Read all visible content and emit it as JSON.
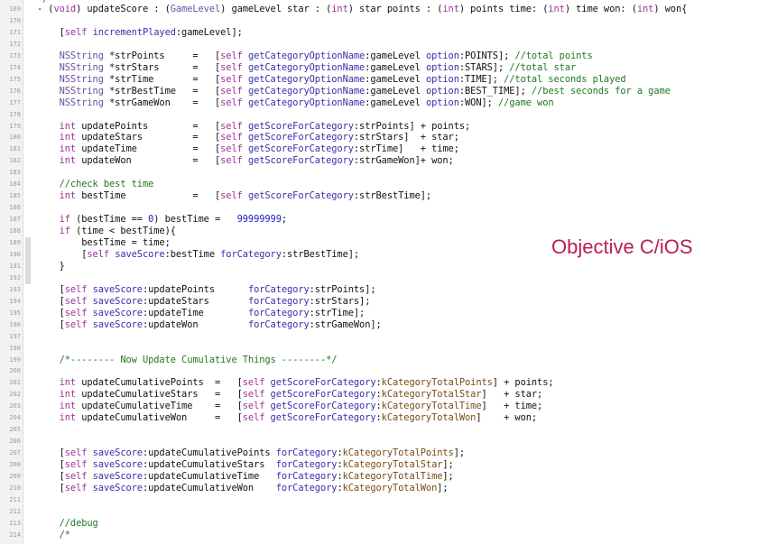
{
  "title_label": "Objective C/iOS",
  "code_lines": [
    {
      "ln": "",
      "y": -7,
      "seg": [
        [
          "cm",
          "*/"
        ]
      ]
    },
    {
      "ln": "169",
      "seg": [
        [
          "",
          "- ("
        ],
        [
          "kw",
          "void"
        ],
        [
          "",
          ") updateScore : ("
        ],
        [
          "cl",
          "GameLevel"
        ],
        [
          "",
          ") gameLevel star : ("
        ],
        [
          "kw",
          "int"
        ],
        [
          "",
          ") star points : ("
        ],
        [
          "kw",
          "int"
        ],
        [
          "",
          ") points time: ("
        ],
        [
          "kw",
          "int"
        ],
        [
          "",
          ") time won: ("
        ],
        [
          "kw",
          "int"
        ],
        [
          "",
          ") won{"
        ]
      ]
    },
    {
      "ln": "170",
      "seg": []
    },
    {
      "ln": "171",
      "seg": [
        [
          "",
          "    ["
        ],
        [
          "kw",
          "self"
        ],
        [
          "",
          " "
        ],
        [
          "fn",
          "incrementPlayed"
        ],
        [
          "",
          ":gameLevel];"
        ]
      ]
    },
    {
      "ln": "172",
      "seg": []
    },
    {
      "ln": "173",
      "seg": [
        [
          "",
          "    "
        ],
        [
          "cl",
          "NSString"
        ],
        [
          "",
          " *strPoints     =   ["
        ],
        [
          "kw",
          "self"
        ],
        [
          "",
          " "
        ],
        [
          "fn",
          "getCategoryOptionName"
        ],
        [
          "",
          ":gameLevel "
        ],
        [
          "fn",
          "option"
        ],
        [
          "",
          ":POINTS]; "
        ],
        [
          "cm",
          "//total points"
        ]
      ]
    },
    {
      "ln": "174",
      "seg": [
        [
          "",
          "    "
        ],
        [
          "cl",
          "NSString"
        ],
        [
          "",
          " *strStars      =   ["
        ],
        [
          "kw",
          "self"
        ],
        [
          "",
          " "
        ],
        [
          "fn",
          "getCategoryOptionName"
        ],
        [
          "",
          ":gameLevel "
        ],
        [
          "fn",
          "option"
        ],
        [
          "",
          ":STARS]; "
        ],
        [
          "cm",
          "//total star"
        ]
      ]
    },
    {
      "ln": "175",
      "seg": [
        [
          "",
          "    "
        ],
        [
          "cl",
          "NSString"
        ],
        [
          "",
          " *strTime       =   ["
        ],
        [
          "kw",
          "self"
        ],
        [
          "",
          " "
        ],
        [
          "fn",
          "getCategoryOptionName"
        ],
        [
          "",
          ":gameLevel "
        ],
        [
          "fn",
          "option"
        ],
        [
          "",
          ":TIME]; "
        ],
        [
          "cm",
          "//total seconds played"
        ]
      ]
    },
    {
      "ln": "176",
      "seg": [
        [
          "",
          "    "
        ],
        [
          "cl",
          "NSString"
        ],
        [
          "",
          " *strBestTime   =   ["
        ],
        [
          "kw",
          "self"
        ],
        [
          "",
          " "
        ],
        [
          "fn",
          "getCategoryOptionName"
        ],
        [
          "",
          ":gameLevel "
        ],
        [
          "fn",
          "option"
        ],
        [
          "",
          ":BEST_TIME]; "
        ],
        [
          "cm",
          "//best seconds for a game"
        ]
      ]
    },
    {
      "ln": "177",
      "seg": [
        [
          "",
          "    "
        ],
        [
          "cl",
          "NSString"
        ],
        [
          "",
          " *strGameWon    =   ["
        ],
        [
          "kw",
          "self"
        ],
        [
          "",
          " "
        ],
        [
          "fn",
          "getCategoryOptionName"
        ],
        [
          "",
          ":gameLevel "
        ],
        [
          "fn",
          "option"
        ],
        [
          "",
          ":WON]; "
        ],
        [
          "cm",
          "//game won"
        ]
      ]
    },
    {
      "ln": "178",
      "seg": []
    },
    {
      "ln": "179",
      "seg": [
        [
          "",
          "    "
        ],
        [
          "kw",
          "int"
        ],
        [
          "",
          " updatePoints        =   ["
        ],
        [
          "kw",
          "self"
        ],
        [
          "",
          " "
        ],
        [
          "fn",
          "getScoreForCategory"
        ],
        [
          "",
          ":strPoints] + points;"
        ]
      ]
    },
    {
      "ln": "180",
      "seg": [
        [
          "",
          "    "
        ],
        [
          "kw",
          "int"
        ],
        [
          "",
          " updateStars         =   ["
        ],
        [
          "kw",
          "self"
        ],
        [
          "",
          " "
        ],
        [
          "fn",
          "getScoreForCategory"
        ],
        [
          "",
          ":strStars]  + star;"
        ]
      ]
    },
    {
      "ln": "181",
      "seg": [
        [
          "",
          "    "
        ],
        [
          "kw",
          "int"
        ],
        [
          "",
          " updateTime          =   ["
        ],
        [
          "kw",
          "self"
        ],
        [
          "",
          " "
        ],
        [
          "fn",
          "getScoreForCategory"
        ],
        [
          "",
          ":strTime]   + time;"
        ]
      ]
    },
    {
      "ln": "182",
      "seg": [
        [
          "",
          "    "
        ],
        [
          "kw",
          "int"
        ],
        [
          "",
          " updateWon           =   ["
        ],
        [
          "kw",
          "self"
        ],
        [
          "",
          " "
        ],
        [
          "fn",
          "getScoreForCategory"
        ],
        [
          "",
          ":strGameWon]+ won;"
        ]
      ]
    },
    {
      "ln": "183",
      "seg": []
    },
    {
      "ln": "184",
      "seg": [
        [
          "",
          "    "
        ],
        [
          "cm",
          "//check best time"
        ]
      ]
    },
    {
      "ln": "185",
      "seg": [
        [
          "",
          "    "
        ],
        [
          "kw",
          "int"
        ],
        [
          "",
          " bestTime            =   ["
        ],
        [
          "kw",
          "self"
        ],
        [
          "",
          " "
        ],
        [
          "fn",
          "getScoreForCategory"
        ],
        [
          "",
          ":strBestTime];"
        ]
      ]
    },
    {
      "ln": "186",
      "seg": []
    },
    {
      "ln": "187",
      "seg": [
        [
          "",
          "    "
        ],
        [
          "kw",
          "if"
        ],
        [
          "",
          " (bestTime == "
        ],
        [
          "nm",
          "0"
        ],
        [
          "",
          ") bestTime =   "
        ],
        [
          "nm",
          "99999999"
        ],
        [
          "",
          ";"
        ]
      ]
    },
    {
      "ln": "188",
      "seg": [
        [
          "",
          "    "
        ],
        [
          "kw",
          "if"
        ],
        [
          "",
          " (time < bestTime){"
        ]
      ]
    },
    {
      "ln": "189",
      "seg": [
        [
          "",
          "        bestTime = time;"
        ]
      ]
    },
    {
      "ln": "190",
      "seg": [
        [
          "",
          "        ["
        ],
        [
          "kw",
          "self"
        ],
        [
          "",
          " "
        ],
        [
          "fn",
          "saveScore"
        ],
        [
          "",
          ":bestTime "
        ],
        [
          "fn",
          "forCategory"
        ],
        [
          "",
          ":strBestTime];"
        ]
      ]
    },
    {
      "ln": "191",
      "seg": [
        [
          "",
          "    }"
        ]
      ]
    },
    {
      "ln": "192",
      "seg": []
    },
    {
      "ln": "193",
      "seg": [
        [
          "",
          "    ["
        ],
        [
          "kw",
          "self"
        ],
        [
          "",
          " "
        ],
        [
          "fn",
          "saveScore"
        ],
        [
          "",
          ":updatePoints      "
        ],
        [
          "fn",
          "forCategory"
        ],
        [
          "",
          ":strPoints];"
        ]
      ]
    },
    {
      "ln": "194",
      "seg": [
        [
          "",
          "    ["
        ],
        [
          "kw",
          "self"
        ],
        [
          "",
          " "
        ],
        [
          "fn",
          "saveScore"
        ],
        [
          "",
          ":updateStars       "
        ],
        [
          "fn",
          "forCategory"
        ],
        [
          "",
          ":strStars];"
        ]
      ]
    },
    {
      "ln": "195",
      "seg": [
        [
          "",
          "    ["
        ],
        [
          "kw",
          "self"
        ],
        [
          "",
          " "
        ],
        [
          "fn",
          "saveScore"
        ],
        [
          "",
          ":updateTime        "
        ],
        [
          "fn",
          "forCategory"
        ],
        [
          "",
          ":strTime];"
        ]
      ]
    },
    {
      "ln": "196",
      "seg": [
        [
          "",
          "    ["
        ],
        [
          "kw",
          "self"
        ],
        [
          "",
          " "
        ],
        [
          "fn",
          "saveScore"
        ],
        [
          "",
          ":updateWon         "
        ],
        [
          "fn",
          "forCategory"
        ],
        [
          "",
          ":strGameWon];"
        ]
      ]
    },
    {
      "ln": "197",
      "seg": []
    },
    {
      "ln": "198",
      "seg": []
    },
    {
      "ln": "199",
      "seg": [
        [
          "",
          "    "
        ],
        [
          "cm",
          "/*-------- Now Update Cumulative Things --------*/"
        ]
      ]
    },
    {
      "ln": "200",
      "seg": []
    },
    {
      "ln": "201",
      "seg": [
        [
          "",
          "    "
        ],
        [
          "kw",
          "int"
        ],
        [
          "",
          " updateCumulativePoints  =   ["
        ],
        [
          "kw",
          "self"
        ],
        [
          "",
          " "
        ],
        [
          "fn",
          "getScoreForCategory"
        ],
        [
          "",
          ":"
        ],
        [
          "cn",
          "kCategoryTotalPoints"
        ],
        [
          "",
          "] + points;"
        ]
      ]
    },
    {
      "ln": "202",
      "seg": [
        [
          "",
          "    "
        ],
        [
          "kw",
          "int"
        ],
        [
          "",
          " updateCumulativeStars   =   ["
        ],
        [
          "kw",
          "self"
        ],
        [
          "",
          " "
        ],
        [
          "fn",
          "getScoreForCategory"
        ],
        [
          "",
          ":"
        ],
        [
          "cn",
          "kCategoryTotalStar"
        ],
        [
          "",
          "]   + star;"
        ]
      ]
    },
    {
      "ln": "203",
      "seg": [
        [
          "",
          "    "
        ],
        [
          "kw",
          "int"
        ],
        [
          "",
          " updateCumulativeTime    =   ["
        ],
        [
          "kw",
          "self"
        ],
        [
          "",
          " "
        ],
        [
          "fn",
          "getScoreForCategory"
        ],
        [
          "",
          ":"
        ],
        [
          "cn",
          "kCategoryTotalTime"
        ],
        [
          "",
          "]   + time;"
        ]
      ]
    },
    {
      "ln": "204",
      "seg": [
        [
          "",
          "    "
        ],
        [
          "kw",
          "int"
        ],
        [
          "",
          " updateCumulativeWon     =   ["
        ],
        [
          "kw",
          "self"
        ],
        [
          "",
          " "
        ],
        [
          "fn",
          "getScoreForCategory"
        ],
        [
          "",
          ":"
        ],
        [
          "cn",
          "kCategoryTotalWon"
        ],
        [
          "",
          "]    + won;"
        ]
      ]
    },
    {
      "ln": "205",
      "seg": []
    },
    {
      "ln": "206",
      "seg": []
    },
    {
      "ln": "207",
      "seg": [
        [
          "",
          "    ["
        ],
        [
          "kw",
          "self"
        ],
        [
          "",
          " "
        ],
        [
          "fn",
          "saveScore"
        ],
        [
          "",
          ":updateCumulativePoints "
        ],
        [
          "fn",
          "forCategory"
        ],
        [
          "",
          ":"
        ],
        [
          "cn",
          "kCategoryTotalPoints"
        ],
        [
          "",
          "];"
        ]
      ]
    },
    {
      "ln": "208",
      "seg": [
        [
          "",
          "    ["
        ],
        [
          "kw",
          "self"
        ],
        [
          "",
          " "
        ],
        [
          "fn",
          "saveScore"
        ],
        [
          "",
          ":updateCumulativeStars  "
        ],
        [
          "fn",
          "forCategory"
        ],
        [
          "",
          ":"
        ],
        [
          "cn",
          "kCategoryTotalStar"
        ],
        [
          "",
          "];"
        ]
      ]
    },
    {
      "ln": "209",
      "seg": [
        [
          "",
          "    ["
        ],
        [
          "kw",
          "self"
        ],
        [
          "",
          " "
        ],
        [
          "fn",
          "saveScore"
        ],
        [
          "",
          ":updateCumulativeTime   "
        ],
        [
          "fn",
          "forCategory"
        ],
        [
          "",
          ":"
        ],
        [
          "cn",
          "kCategoryTotalTime"
        ],
        [
          "",
          "];"
        ]
      ]
    },
    {
      "ln": "210",
      "seg": [
        [
          "",
          "    ["
        ],
        [
          "kw",
          "self"
        ],
        [
          "",
          " "
        ],
        [
          "fn",
          "saveScore"
        ],
        [
          "",
          ":updateCumulativeWon    "
        ],
        [
          "fn",
          "forCategory"
        ],
        [
          "",
          ":"
        ],
        [
          "cn",
          "kCategoryTotalWon"
        ],
        [
          "",
          "];"
        ]
      ]
    },
    {
      "ln": "211",
      "seg": []
    },
    {
      "ln": "212",
      "seg": []
    },
    {
      "ln": "213",
      "seg": [
        [
          "",
          "    "
        ],
        [
          "cm",
          "//debug"
        ]
      ]
    },
    {
      "ln": "214",
      "seg": [
        [
          "",
          "    "
        ],
        [
          "cm",
          "/*"
        ]
      ]
    }
  ]
}
